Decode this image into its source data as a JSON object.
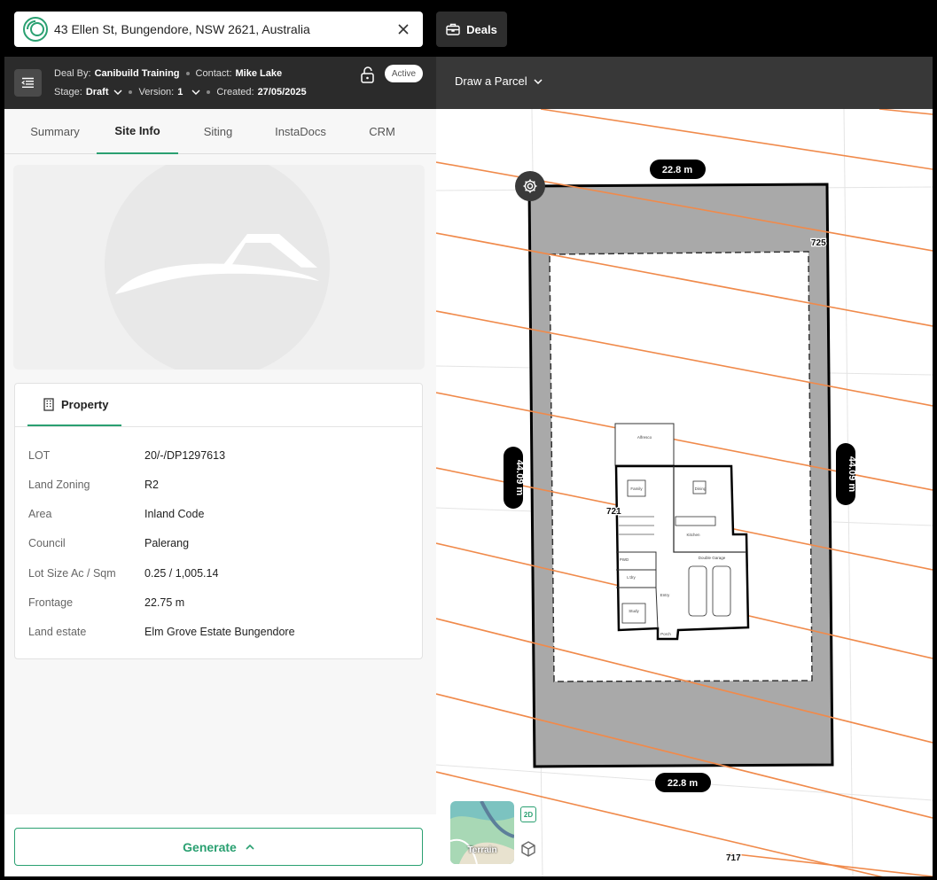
{
  "search": {
    "address": "43 Ellen St, Bungendore, NSW 2621, Australia"
  },
  "topbar": {
    "deals_label": "Deals"
  },
  "deal": {
    "deal_by_label": "Deal By:",
    "deal_by": "Canibuild Training",
    "contact_label": "Contact:",
    "contact": "Mike Lake",
    "stage_label": "Stage:",
    "stage": "Draft",
    "version_label": "Version:",
    "version": "1",
    "created_label": "Created:",
    "created": "27/05/2025",
    "status": "Active"
  },
  "tabs": [
    {
      "label": "Summary"
    },
    {
      "label": "Site Info",
      "active": true
    },
    {
      "label": "Siting"
    },
    {
      "label": "InstaDocs"
    },
    {
      "label": "CRM"
    }
  ],
  "property": {
    "tab_label": "Property",
    "rows": [
      {
        "key": "LOT",
        "value": "20/-/DP1297613"
      },
      {
        "key": "Land Zoning",
        "value": "R2"
      },
      {
        "key": "Area",
        "value": "Inland Code"
      },
      {
        "key": "Council",
        "value": "Palerang"
      },
      {
        "key": "Lot Size Ac / Sqm",
        "value": "0.25 / 1,005.14"
      },
      {
        "key": "Frontage",
        "value": "22.75 m"
      },
      {
        "key": "Land estate",
        "value": "Elm Grove Estate Bungendore"
      }
    ]
  },
  "generate_label": "Generate",
  "map": {
    "draw_parcel_label": "Draw a Parcel",
    "dim_top": "22.8 m",
    "dim_bottom": "22.8 m",
    "dim_left": "44.09 m",
    "dim_right": "44.09 m",
    "contour_labels": [
      "725",
      "721",
      "717"
    ],
    "room_labels": [
      "Alfresco",
      "Family",
      "Dining",
      "Kitchen",
      "PWD",
      "L'dry",
      "Study",
      "Entry",
      "Porch",
      "Double Garage"
    ],
    "terrain_label": "Terrain",
    "view_2d_label": "2D"
  },
  "colors": {
    "accent": "#2aa071",
    "contour": "#f08a4b",
    "setback": "#a9a9a9"
  }
}
